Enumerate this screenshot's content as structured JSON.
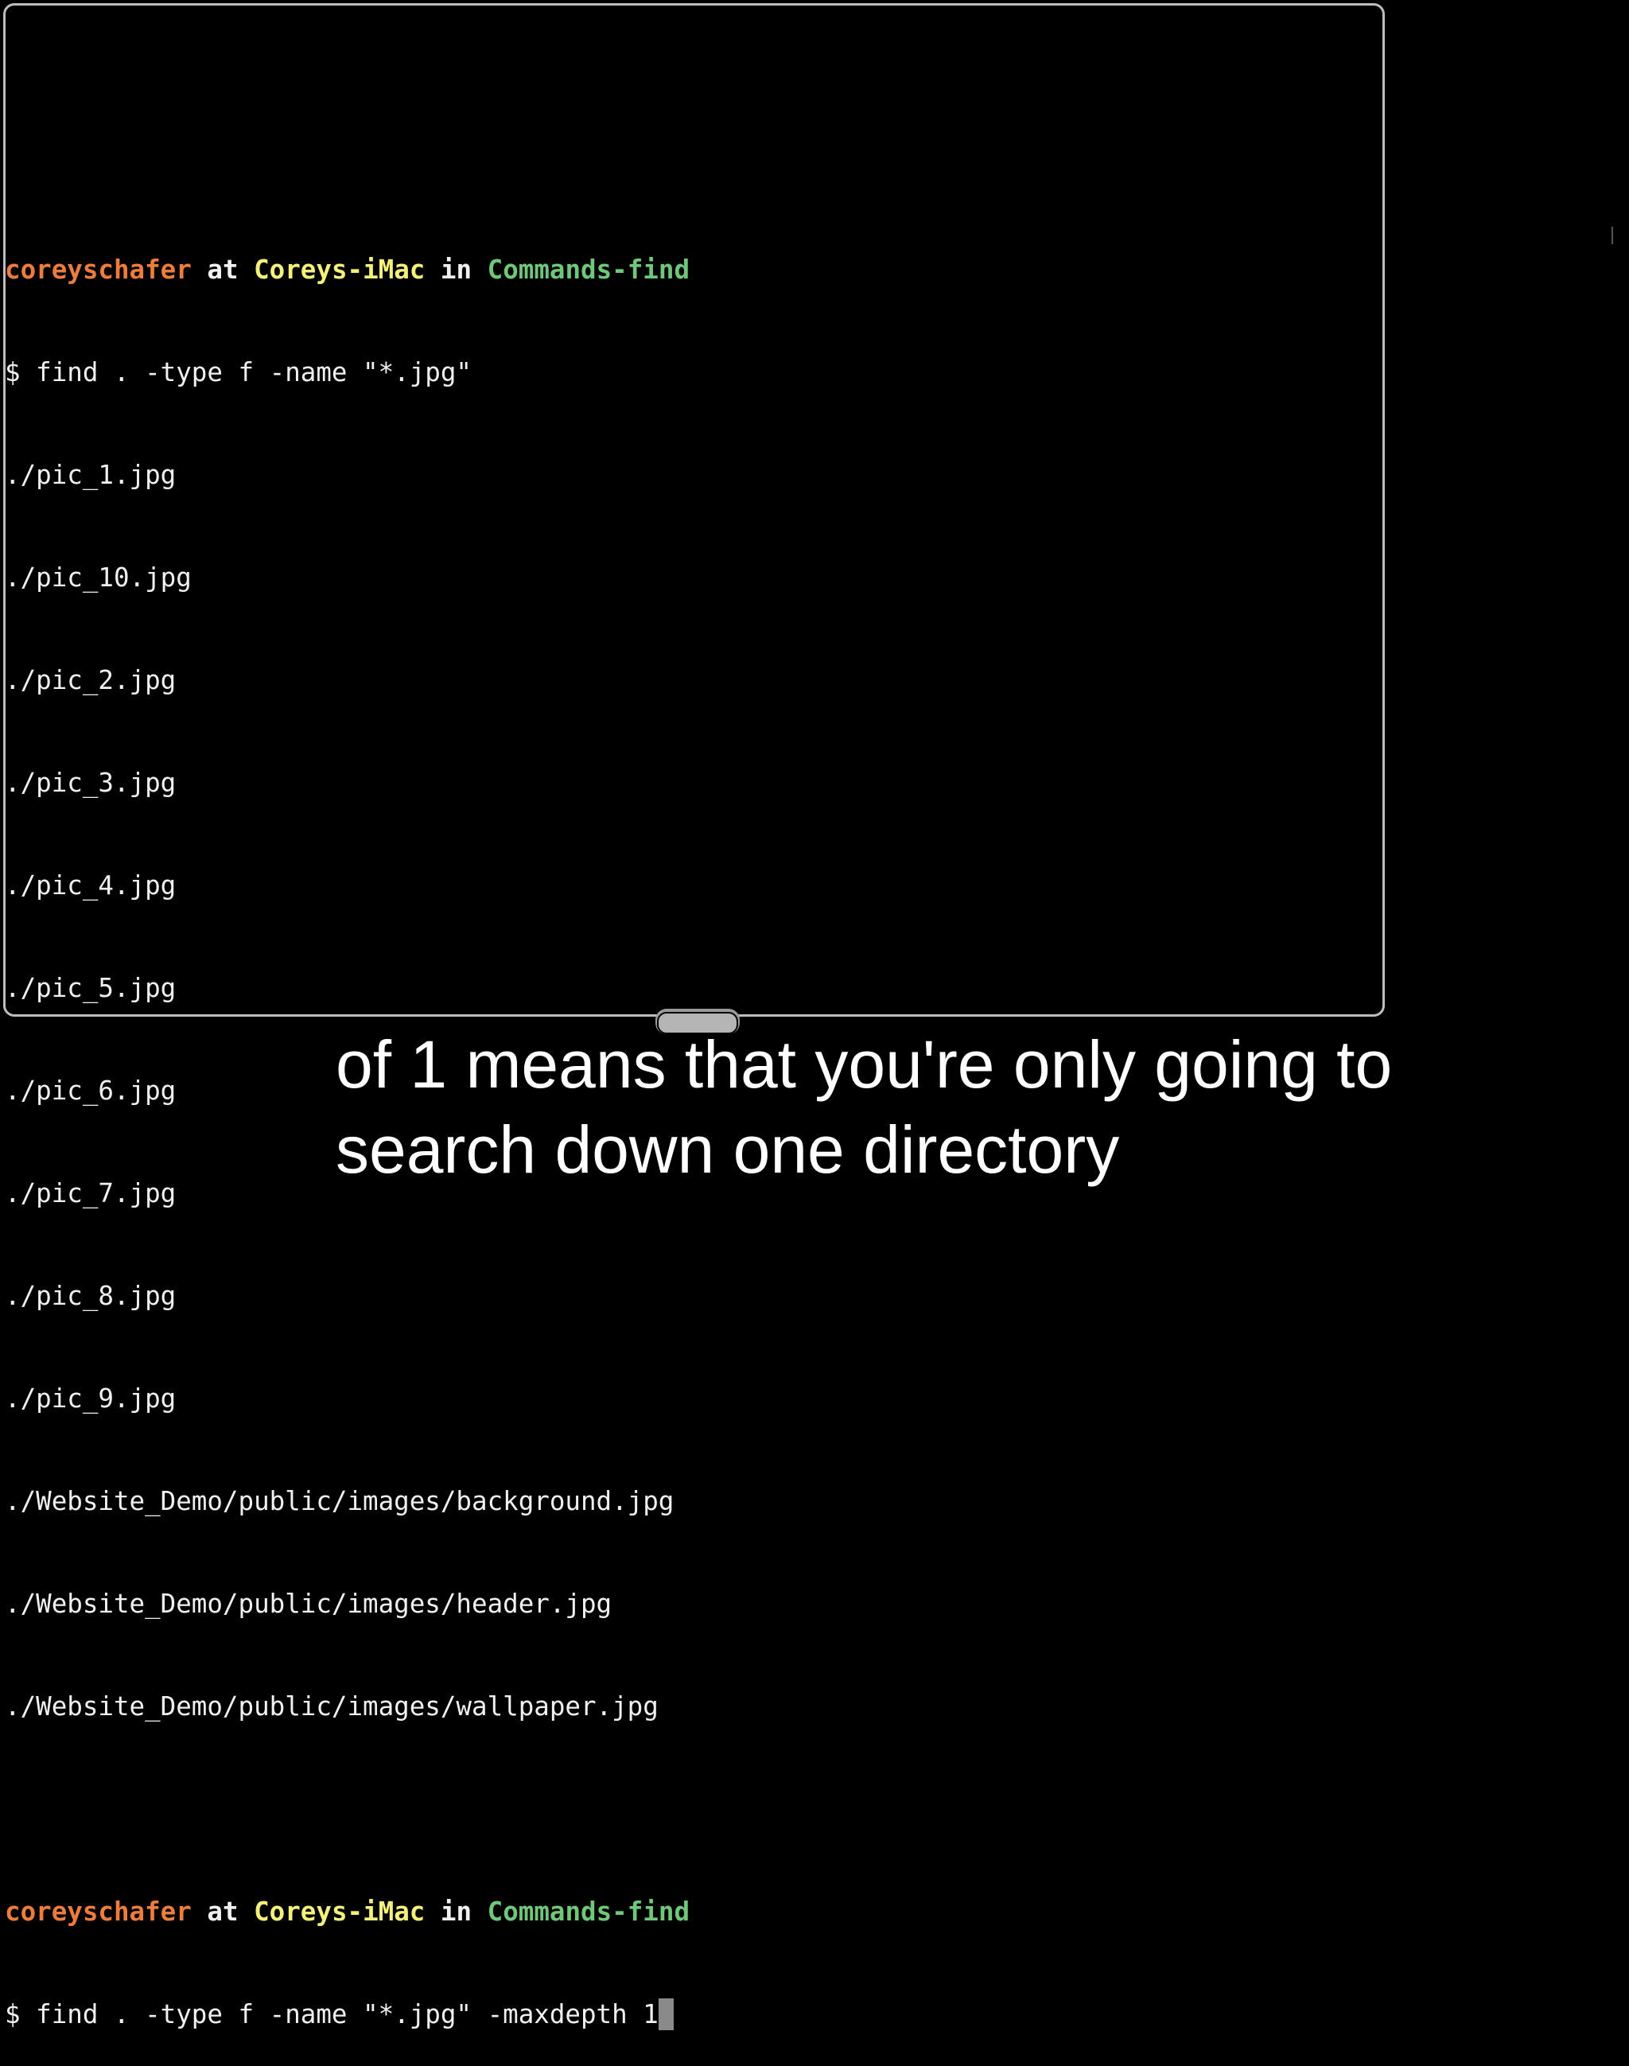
{
  "terminal": {
    "prompt": {
      "user": "coreyschafer",
      "at": "at",
      "host": "Coreys-iMac",
      "in": "in",
      "dir": "Commands-find"
    },
    "command1": "$ find . -type f -name \"*.jpg\"",
    "output": [
      "./pic_1.jpg",
      "./pic_10.jpg",
      "./pic_2.jpg",
      "./pic_3.jpg",
      "./pic_4.jpg",
      "./pic_5.jpg",
      "./pic_6.jpg",
      "./pic_7.jpg",
      "./pic_8.jpg",
      "./pic_9.jpg",
      "./Website_Demo/public/images/background.jpg",
      "./Website_Demo/public/images/header.jpg",
      "./Website_Demo/public/images/wallpaper.jpg"
    ],
    "command2": "$ find . -type f -name \"*.jpg\" -maxdepth 1",
    "colors": {
      "user": "#ee7c3c",
      "host": "#f5f07a",
      "dir": "#6fc77a"
    }
  },
  "caption": {
    "line1": "of 1 means that you're only going to",
    "line2": "search down one directory"
  }
}
